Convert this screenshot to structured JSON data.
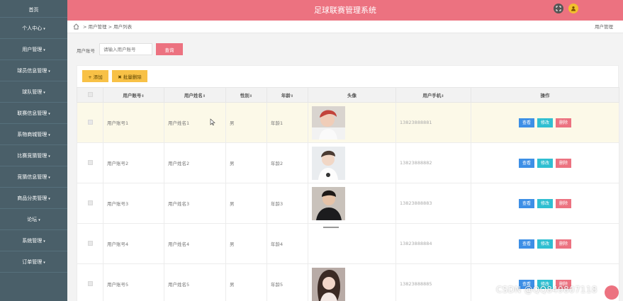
{
  "header": {
    "title": "足球联赛管理系统"
  },
  "sidebar": {
    "items": [
      {
        "label": "首页",
        "caret": ""
      },
      {
        "label": "个人中心",
        "caret": "▾"
      },
      {
        "label": "用户管理",
        "caret": "▾"
      },
      {
        "label": "球员信息管理",
        "caret": "▾"
      },
      {
        "label": "球队管理",
        "caret": "▾"
      },
      {
        "label": "联赛信息管理",
        "caret": "▾"
      },
      {
        "label": "系物商城管理",
        "caret": "▾"
      },
      {
        "label": "比赛竞猜管理",
        "caret": "▾"
      },
      {
        "label": "竞猜信息管理",
        "caret": "▾"
      },
      {
        "label": "商品分类管理",
        "caret": "▾"
      },
      {
        "label": "论坛",
        "caret": "▾"
      },
      {
        "label": "系统管理",
        "caret": "▾"
      },
      {
        "label": "订单管理",
        "caret": "▾"
      }
    ]
  },
  "breadcrumb": {
    "path": "> 用户管理 > 用户列表",
    "right": "用户管理"
  },
  "search": {
    "label": "用户账号",
    "placeholder": "请输入用户账号",
    "button": "查询"
  },
  "toolbar": {
    "add": "+ 添加",
    "batch_delete": "✖ 批量删除"
  },
  "table": {
    "headers": [
      "用户账号",
      "用户姓名",
      "性别",
      "年龄",
      "头像",
      "用户手机",
      "操作"
    ],
    "sort_mark": "⇕",
    "ops": {
      "view": "查看",
      "edit": "修改",
      "delete": "删除"
    },
    "rows": [
      {
        "account": "用户账号1",
        "name": "用户姓名1",
        "gender": "男",
        "age": "年龄1",
        "phone": "13823888881",
        "avatar": true
      },
      {
        "account": "用户账号2",
        "name": "用户姓名2",
        "gender": "男",
        "age": "年龄2",
        "phone": "13823888882",
        "avatar": true
      },
      {
        "account": "用户账号3",
        "name": "用户姓名3",
        "gender": "男",
        "age": "年龄3",
        "phone": "13823888883",
        "avatar": true
      },
      {
        "account": "用户账号4",
        "name": "用户姓名4",
        "gender": "男",
        "age": "年龄4",
        "phone": "13823888884",
        "avatar": false
      },
      {
        "account": "用户账号5",
        "name": "用户姓名5",
        "gender": "男",
        "age": "年龄5",
        "phone": "13823888885",
        "avatar": true
      }
    ]
  },
  "watermark": "CSDN @QQ849807118",
  "colors": {
    "accent": "#ec7280",
    "sidebar": "#4a5f69",
    "warning": "#f8c146",
    "info": "#3d8fe6",
    "teal": "#2fbfd1"
  }
}
